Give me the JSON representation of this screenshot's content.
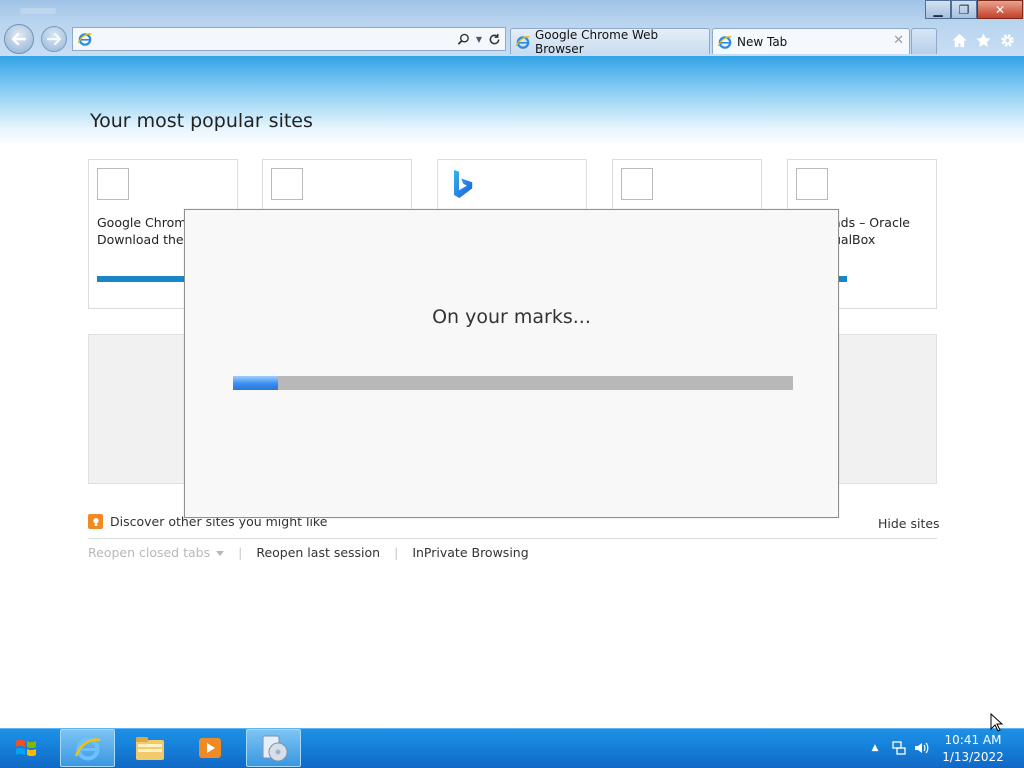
{
  "browser": {
    "address": {
      "value": "",
      "placeholder": ""
    },
    "tabs": [
      {
        "label": "Google Chrome Web Browser",
        "active": false
      },
      {
        "label": "New Tab",
        "active": true
      }
    ],
    "window_controls": {
      "minimize": "minimize",
      "maximize": "restore",
      "close": "close"
    },
    "toolbar_icons": [
      "home-icon",
      "favorites-star-icon",
      "settings-gear-icon"
    ]
  },
  "newtab": {
    "title": "Your most popular sites",
    "tiles": [
      {
        "name": "Google Chrom\nDownload the I",
        "icon": "blank-favicon",
        "has_bar": true
      },
      {
        "name": "",
        "icon": "blank-favicon",
        "has_bar": false
      },
      {
        "name": "",
        "icon": "bing-logo-icon",
        "has_bar": false
      },
      {
        "name": "",
        "icon": "blank-favicon",
        "has_bar": false
      },
      {
        "name": "ads – Oracle\nualBox",
        "icon": "blank-favicon",
        "has_bar": true
      }
    ],
    "discover_label": "Discover other sites you might like",
    "hide_sites_label": "Hide sites",
    "reopen_closed_tabs_label": "Reopen closed tabs",
    "reopen_last_session_label": "Reopen last session",
    "inprivate_label": "InPrivate Browsing"
  },
  "dialog": {
    "message": "On your marks...",
    "progress": 0.08
  },
  "taskbar": {
    "pinned": [
      "internet-explorer-icon",
      "file-explorer-icon",
      "media-player-icon",
      "installer-icon"
    ],
    "clock_time": "10:41 AM",
    "clock_date": "1/13/2022"
  },
  "colors": {
    "accent": "#1a86c6",
    "taskbar": "#157fd8",
    "progress_fill": "#3a8df0",
    "progress_track": "#b8b8b8"
  }
}
